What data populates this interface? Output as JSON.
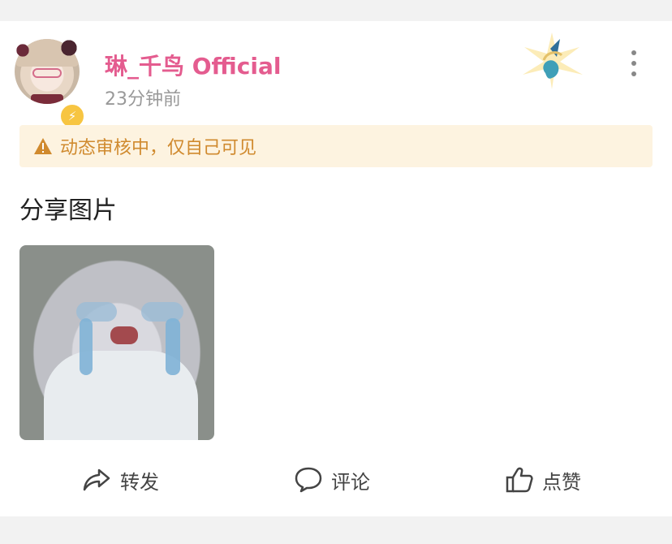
{
  "post": {
    "author": "琳_千鸟 Official",
    "time": "23分钟前",
    "notice": "动态审核中，仅自己可见",
    "text": "分享图片"
  },
  "actions": {
    "share": "转发",
    "comment": "评论",
    "like": "点赞"
  },
  "icons": {
    "badge": "lightning-icon",
    "more": "more-vertical-icon",
    "warning": "warning-icon",
    "share": "share-arrow-icon",
    "comment": "comment-bubble-icon",
    "like": "thumbs-up-icon"
  },
  "colors": {
    "username": "#e45c8f",
    "notice_bg": "#fdf3e0",
    "notice_text": "#d08a2e",
    "badge": "#f7c542"
  }
}
